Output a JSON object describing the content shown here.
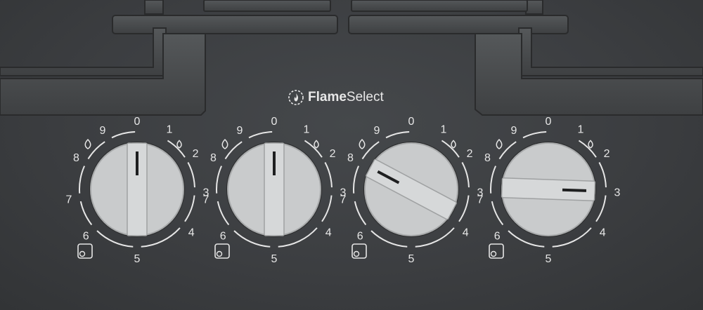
{
  "brand": {
    "word1": "Flame",
    "word2": "Select",
    "icon": "flame-select-icon"
  },
  "colors": {
    "panel": "#3b3d3f",
    "grate": "#4a4c4c",
    "knob": "#c9cbcc",
    "marking": "#e6e6e6"
  },
  "knobs": [
    {
      "id": "knob-1",
      "setting": "0",
      "scale": [
        "9",
        "8",
        "7",
        "6",
        "5",
        "4",
        "3",
        "2",
        "1"
      ],
      "top_label": "0",
      "zone_icon": "burner-rear-left-icon"
    },
    {
      "id": "knob-2",
      "setting": "0",
      "scale": [
        "9",
        "8",
        "7",
        "6",
        "5",
        "4",
        "3",
        "2",
        "1"
      ],
      "top_label": "0",
      "zone_icon": "burner-front-left-icon"
    },
    {
      "id": "knob-3",
      "setting": "8",
      "scale": [
        "9",
        "8",
        "7",
        "6",
        "5",
        "4",
        "3",
        "2",
        "1"
      ],
      "top_label": "0",
      "zone_icon": "burner-front-right-icon"
    },
    {
      "id": "knob-4",
      "setting": "3",
      "scale": [
        "9",
        "8",
        "7",
        "6",
        "5",
        "4",
        "3",
        "2",
        "1"
      ],
      "top_label": "0",
      "zone_icon": "burner-rear-right-icon"
    }
  ]
}
